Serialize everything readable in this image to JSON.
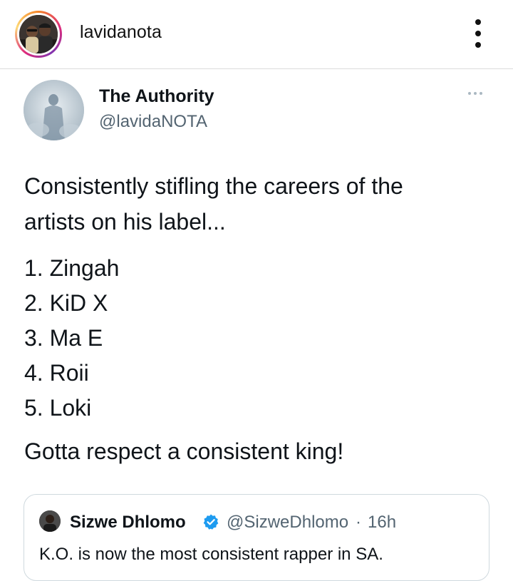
{
  "instagram_header": {
    "username": "lavidanota",
    "icons": {
      "avatar": "profile-photo",
      "more": "vertical-ellipsis-icon"
    }
  },
  "tweet": {
    "display_name": "The Authority",
    "handle": "@lavidaNOTA",
    "text_line_1": "Consistently stifling the careers of the",
    "text_line_2": "artists on his label...",
    "list": [
      "1. Zingah",
      "2. KiD X",
      "3. Ma E",
      "4. Roii",
      "5. Loki"
    ],
    "closing_line": "Gotta respect a consistent king!",
    "icons": {
      "more": "horizontal-ellipsis-icon"
    }
  },
  "quoted_tweet": {
    "display_name": "Sizwe Dhlomo",
    "verified_icon": "verified-badge-icon",
    "handle": "@SizweDhlomo",
    "separator": "·",
    "time": "16h",
    "text": "K.O. is now the most consistent rapper in SA."
  },
  "colors": {
    "text_primary": "#0f1419",
    "text_secondary": "#536471",
    "verified_blue": "#1d9bf0",
    "border": "#cfd9de"
  }
}
